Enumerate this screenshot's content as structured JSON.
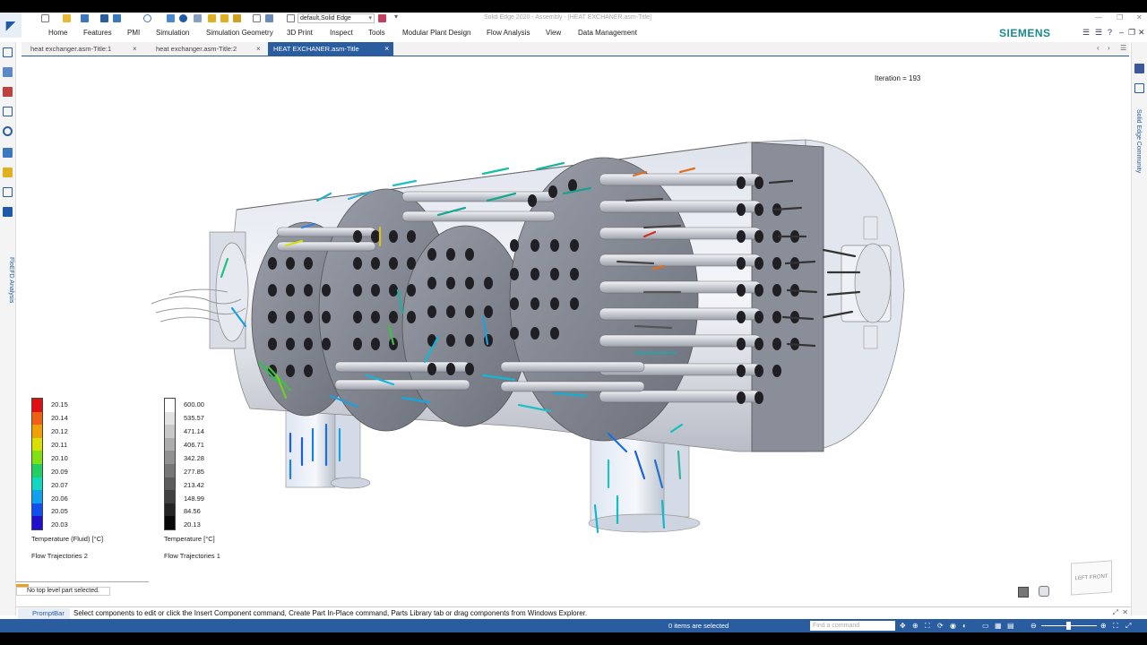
{
  "window": {
    "title": "Solid Edge 2020 - Assembly - [HEAT EXCHANER.asm-Title]",
    "view_combo": "default,Solid Edge"
  },
  "ribbon": {
    "tabs": [
      "Home",
      "Features",
      "PMI",
      "Simulation",
      "Simulation Geometry",
      "3D Print",
      "Inspect",
      "Tools",
      "Modular Plant Design",
      "Flow Analysis",
      "View",
      "Data Management"
    ],
    "brand": "SIEMENS"
  },
  "doc_tabs": [
    {
      "label": "heat exchanger.asm-Title:1",
      "close": "×"
    },
    {
      "label": "heat exchanger.asm-Title:2",
      "close": "×"
    },
    {
      "label": "HEAT EXCHANER.asm-Title",
      "close": "×"
    }
  ],
  "left_rail": {
    "floefd_label": "FloEFD Analysis"
  },
  "right_rail": {
    "community_label": "Solid Edge Community"
  },
  "viewport": {
    "iteration": "Iteration = 193",
    "legend_fluid": {
      "ticks": [
        "20.15",
        "20.14",
        "20.12",
        "20.11",
        "20.10",
        "20.09",
        "20.07",
        "20.06",
        "20.05",
        "20.03"
      ],
      "title": "Temperature (Fluid) [°C]",
      "subtitle": "Flow Trajectories 2",
      "colors": [
        "#e01010",
        "#f06010",
        "#f0a000",
        "#d8e000",
        "#80e010",
        "#20d060",
        "#10d8c0",
        "#10a0f0",
        "#1050f0",
        "#2010d0"
      ]
    },
    "legend_solid": {
      "ticks": [
        "600.00",
        "535.57",
        "471.14",
        "406.71",
        "342.28",
        "277.85",
        "213.42",
        "148.99",
        "84.56",
        "20.13"
      ],
      "title": "Temperature [°C]",
      "subtitle": "Flow Trajectories 1",
      "colors": [
        "#ffffff",
        "#e2e2e2",
        "#c8c8c8",
        "#adadad",
        "#929292",
        "#777777",
        "#5c5c5c",
        "#404040",
        "#242424",
        "#080808"
      ]
    },
    "view_cube_label": "LEFT FRONT"
  },
  "status": {
    "message_box": "No top level part selected.",
    "promptbar_label": "PromptBar",
    "prompt_text": "Select components to edit or click the Insert Component command, Create Part In-Place command, Parts Library tab or drag components from Windows Explorer.",
    "selection": "0 items are selected",
    "find_placeholder": "Find a command"
  }
}
